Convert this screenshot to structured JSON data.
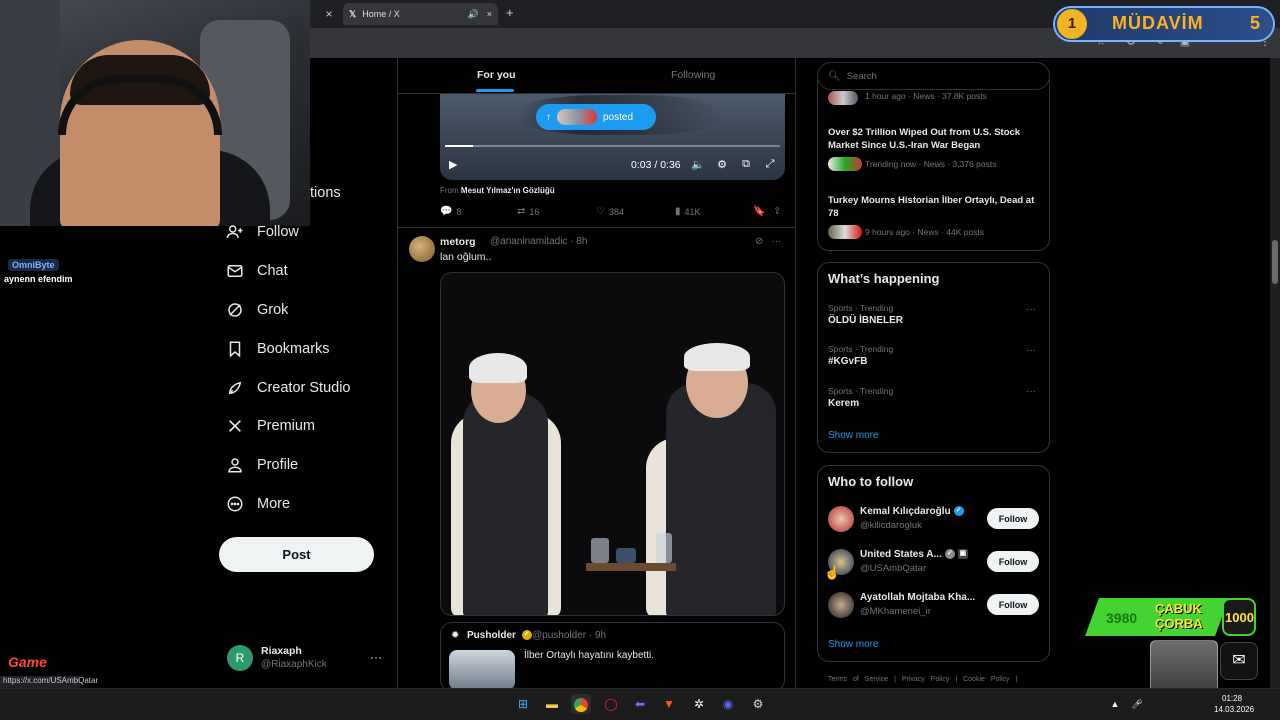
{
  "browser": {
    "tab_title": "Home / X",
    "tab_close": "×",
    "new_tab": "+"
  },
  "overlay": {
    "level": "1",
    "title": "MÜDAVİM",
    "count": "5",
    "chat_user": "OmniByte",
    "chat_message": "aynenn efendim",
    "sub_count": "3980",
    "sub_title_1": "ÇABUK",
    "sub_title_2": "ÇORBA",
    "goal": "1000",
    "logo": "Game"
  },
  "nav": {
    "partial_label": "tions",
    "items": [
      {
        "label": "Follow",
        "icon": "person-add-icon"
      },
      {
        "label": "Chat",
        "icon": "mail-icon"
      },
      {
        "label": "Grok",
        "icon": "grok-icon"
      },
      {
        "label": "Bookmarks",
        "icon": "bookmark-icon"
      },
      {
        "label": "Creator Studio",
        "icon": "rocket-icon"
      },
      {
        "label": "Premium",
        "icon": "x-logo-icon"
      },
      {
        "label": "Profile",
        "icon": "person-icon"
      },
      {
        "label": "More",
        "icon": "more-circle-icon"
      }
    ],
    "post_label": "Post",
    "account_initial": "R",
    "account_name": "Riaxaph",
    "account_handle": "@RiaxaphKick",
    "account_more": "···"
  },
  "feed": {
    "tabs": [
      "For you",
      "Following"
    ],
    "video": {
      "posted_label": "posted",
      "time": "0:03 / 0:36",
      "progress": 0.083,
      "from_prefix": "From",
      "from_name": "Mesut Yılmaz'ın Gözlüğü"
    },
    "tweet1_actions": {
      "replies": "8",
      "reposts": "16",
      "likes": "384",
      "views": "41K"
    },
    "tweet2": {
      "name": "metorg",
      "handle": "@ananinamitadic · 8h",
      "text": "lan oğlum..",
      "more": "···"
    },
    "quote": {
      "name": "Pusholder",
      "handle": "@pusholder · 9h",
      "text": "İlber Ortaylı hayatını kaybetti."
    }
  },
  "sidebar": {
    "search_placeholder": "Search",
    "news": [
      {
        "title": "",
        "meta": "1 hour ago · News · 37.8K posts"
      },
      {
        "title": "Over $2 Trillion Wiped Out from U.S. Stock Market Since U.S.-Iran War Began",
        "meta": "Trending now · News · 3,376 posts"
      },
      {
        "title": "Turkey Mourns Historian İlber Ortaylı, Dead at 78",
        "meta": "9 hours ago · News · 44K posts"
      }
    ],
    "happening_title": "What’s happening",
    "trends": [
      {
        "meta": "Sports · Trending",
        "name": "ÖLDÜ İBNELER"
      },
      {
        "meta": "Sports · Trending",
        "name": "#KGvFB"
      },
      {
        "meta": "Sports · Trending",
        "name": "Kerem"
      }
    ],
    "show_more": "Show more",
    "wtf_title": "Who to follow",
    "follow": [
      {
        "name": "Kemal Kılıçdaroğlu",
        "handle": "@kilicdarogluk"
      },
      {
        "name": "United States A...",
        "handle": "@USAmbQatar"
      },
      {
        "name": "Ayatollah Mojtaba Kha...",
        "handle": "@MKhamenei_ir"
      }
    ],
    "follow_label": "Follow",
    "footer": "Terms of Service | Privacy Policy | Cookie Policy |"
  },
  "status_url": "https://x.com/USAmbQatar",
  "taskbar": {
    "time": "01:28",
    "date": "14.03.2026"
  },
  "colors": {
    "accent": "#1d9bf0",
    "background": "#000000",
    "border": "#2f3336",
    "muted": "#71767b"
  }
}
